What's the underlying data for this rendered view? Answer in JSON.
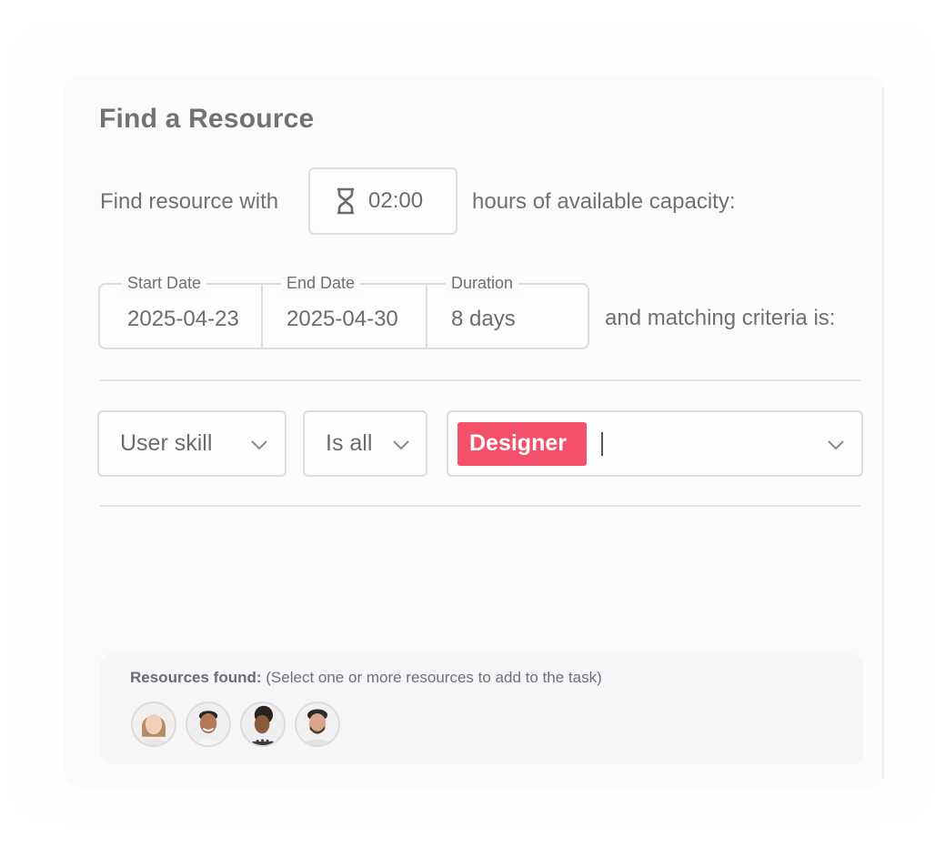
{
  "panel": {
    "title": "Find a Resource"
  },
  "capacity": {
    "prefix": "Find resource with",
    "hours_value": "02:00",
    "suffix": "hours of available capacity:",
    "icon": "hourglass-icon"
  },
  "dates": {
    "start_label": "Start Date",
    "start_value": "2025-04-23",
    "end_label": "End Date",
    "end_value": "2025-04-30",
    "duration_label": "Duration",
    "duration_value": "8 days",
    "suffix": "and matching criteria is:"
  },
  "criteria": {
    "field": "User skill",
    "operator": "Is all",
    "tags": [
      "Designer"
    ],
    "tag_color": "#f4506b",
    "dropdown_icon": "chevron-down-icon"
  },
  "results": {
    "label_bold": "Resources found:",
    "label_hint": "(Select one or more resources to add to the task)",
    "avatars": [
      {
        "icon": "avatar-woman-icon"
      },
      {
        "icon": "avatar-man-icon"
      },
      {
        "icon": "avatar-woman-curly-icon"
      },
      {
        "icon": "avatar-man-beard-icon"
      }
    ]
  }
}
